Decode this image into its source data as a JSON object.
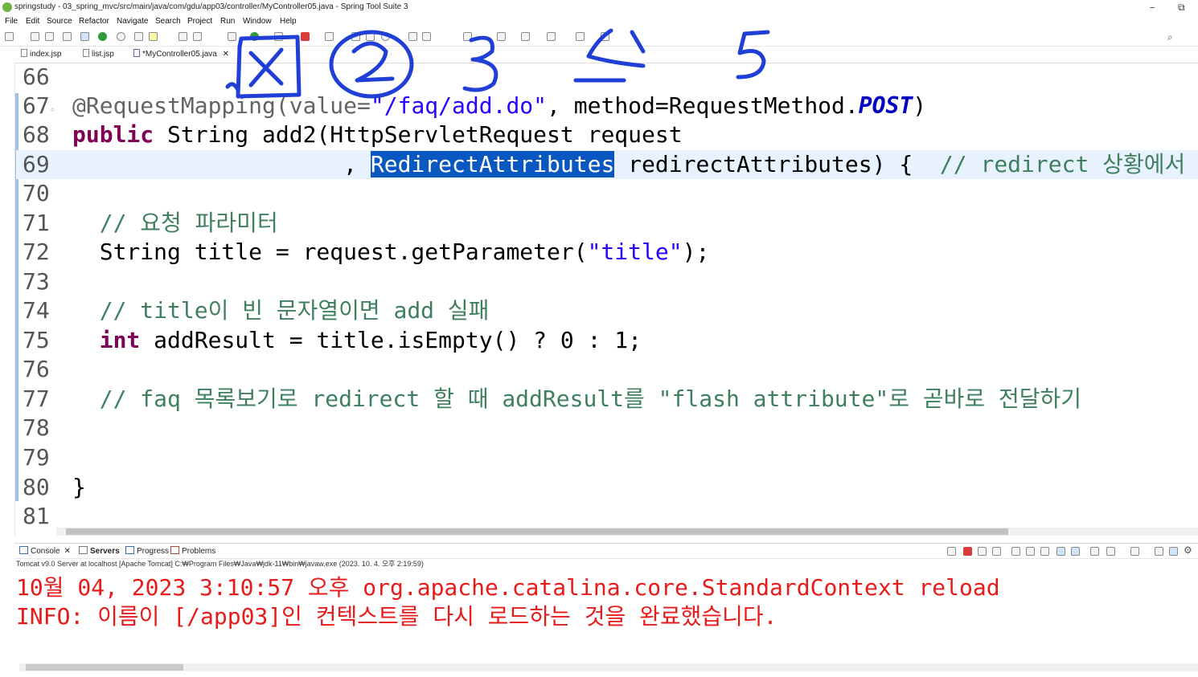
{
  "window": {
    "title": "springstudy - 03_spring_mvc/src/main/java/com/gdu/app03/controller/MyController05.java - Spring Tool Suite 3",
    "minimize": "–",
    "restore": "⧉"
  },
  "menu": [
    "File",
    "Edit",
    "Source",
    "Refactor",
    "Navigate",
    "Search",
    "Project",
    "Run",
    "Window",
    "Help"
  ],
  "editor_tabs": [
    {
      "label": "index.jsp"
    },
    {
      "label": "list.jsp"
    },
    {
      "label": "*MyController05.java",
      "close": "✕"
    }
  ],
  "code_lines": [
    {
      "num": "66"
    },
    {
      "num": "67",
      "marker": "◦",
      "ann": "@RequestMapping(value=",
      "str": "\"/faq/add.do\"",
      "mid": ", method=RequestMethod.",
      "ital": "POST",
      "tail": ")"
    },
    {
      "num": "68",
      "kw": "public",
      "rest": " String add2(HttpServletRequest request"
    },
    {
      "num": "69",
      "pre": "                    , ",
      "sel": "RedirectAttributes",
      "post": " redirectAttributes) {  ",
      "cmt": "// redirect 상황에서 값을 "
    },
    {
      "num": "70"
    },
    {
      "num": "71",
      "cmt": "  // 요청 파라미터"
    },
    {
      "num": "72",
      "pre": "  String title = request.getParameter(",
      "str": "\"title\"",
      "post": ");"
    },
    {
      "num": "73"
    },
    {
      "num": "74",
      "cmt": "  // title이 빈 문자열이면 add 실패"
    },
    {
      "num": "75",
      "kw_pre": "  ",
      "kw": "int",
      "rest": " addResult = title.isEmpty() ? 0 : 1;"
    },
    {
      "num": "76"
    },
    {
      "num": "77",
      "cmt": "  // faq 목록보기로 redirect 할 때 addResult를 \"flash attribute\"로 곧바로 전달하기"
    },
    {
      "num": "78"
    },
    {
      "num": "79"
    },
    {
      "num": "80",
      "rest": "}"
    },
    {
      "num": "81"
    }
  ],
  "console_tabs": [
    "Console",
    "Servers",
    "Progress",
    "Problems"
  ],
  "console_close": "✕",
  "console_header": "Tomcat v9.0 Server at localhost [Apache Tomcat] C:₩Program Files₩Java₩jdk-11₩bin₩javaw.exe  (2023. 10. 4. 오후 2:19:59)",
  "console_lines": [
    "10월 04, 2023 3:10:57 오후 org.apache.catalina.core.StandardContext reload",
    "INFO: 이름이 [/app03]인 컨텍스트를 다시 로드하는 것을 완료했습니다."
  ],
  "colors": {
    "keyword": "#7f0055",
    "string": "#2a00ff",
    "comment": "#3f7f5f",
    "selection": "#0a57c2",
    "console_text": "#e81a1a",
    "ink": "#1f3fd6"
  }
}
